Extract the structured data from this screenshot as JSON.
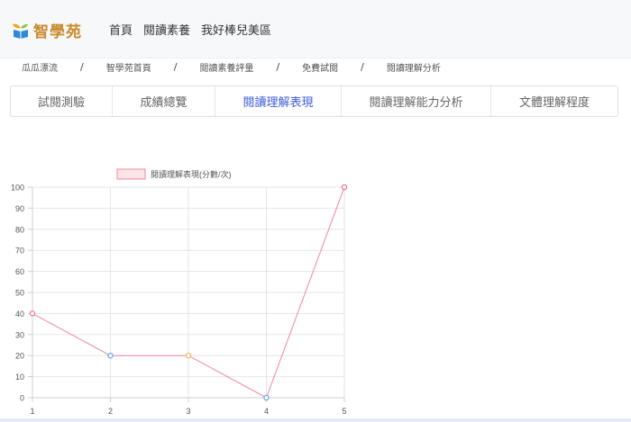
{
  "header": {
    "logo_text": "智學苑",
    "nav": [
      "首頁",
      "閱讀素養",
      "我好棒兒美區"
    ]
  },
  "breadcrumb": [
    "瓜瓜漂流",
    "智學苑首頁",
    "閱讀素養評量",
    "免費試閱",
    "閱讀理解分析"
  ],
  "tabs": [
    {
      "label": "試閱測驗",
      "active": false
    },
    {
      "label": "成績總覽",
      "active": false
    },
    {
      "label": "閱讀理解表現",
      "active": true
    },
    {
      "label": "閱讀理解能力分析",
      "active": false
    },
    {
      "label": "文體理解程度",
      "active": false
    }
  ],
  "colors": {
    "accent": "#3d5bd9",
    "logo": "#c98a2a",
    "line": "#f0879c"
  },
  "chart_data": {
    "type": "line",
    "x": [
      1,
      2,
      3,
      4,
      5
    ],
    "series": [
      {
        "name": "閱讀理解表現(分數/次)",
        "values": [
          40,
          20,
          20,
          0,
          100
        ],
        "line_color": "#f0879c",
        "point_colors": [
          "#f06c8a",
          "#5fa6e3",
          "#f2b65a",
          "#5fa6e3",
          "#f06c8a"
        ]
      }
    ],
    "ylim": [
      0,
      100
    ],
    "yticks": [
      0,
      10,
      20,
      30,
      40,
      50,
      60,
      70,
      80,
      90,
      100
    ],
    "grid": true,
    "legend": "top-center"
  }
}
